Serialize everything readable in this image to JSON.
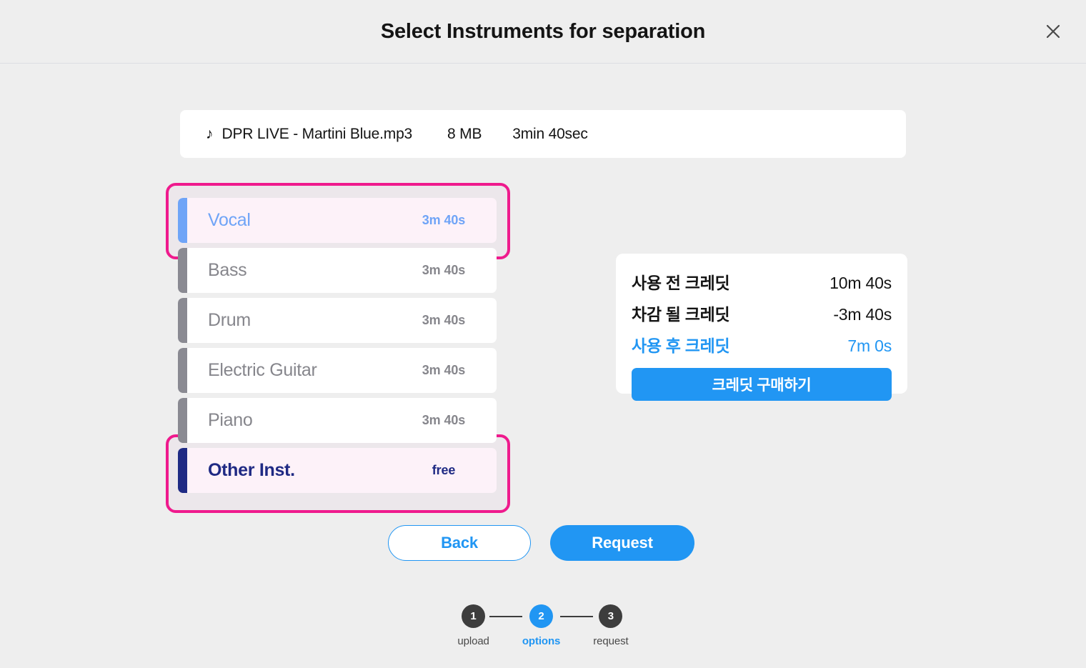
{
  "header": {
    "title": "Select Instruments for separation",
    "close_icon": "close-icon"
  },
  "file": {
    "icon": "music-note-icon",
    "name": "DPR LIVE - Martini Blue.mp3",
    "size": "8 MB",
    "duration": "3min 40sec"
  },
  "instruments": [
    {
      "label": "Vocal",
      "meta": "3m 40s",
      "state": "selected-vocal"
    },
    {
      "label": "Bass",
      "meta": "3m 40s",
      "state": ""
    },
    {
      "label": "Drum",
      "meta": "3m 40s",
      "state": ""
    },
    {
      "label": "Electric Guitar",
      "meta": "3m 40s",
      "state": ""
    },
    {
      "label": "Piano",
      "meta": "3m 40s",
      "state": ""
    },
    {
      "label": "Other Inst.",
      "meta": "free",
      "state": "selected-other"
    }
  ],
  "credits": {
    "before_label": "사용 전 크레딧",
    "before_value": "10m 40s",
    "deduct_label": "차감 될 크레딧",
    "deduct_value": "-3m 40s",
    "after_label": "사용 후 크레딧",
    "after_value": "7m 0s",
    "buy_button": "크레딧 구매하기"
  },
  "actions": {
    "back": "Back",
    "request": "Request"
  },
  "stepper": {
    "steps": [
      {
        "number": "1",
        "label": "upload",
        "active": false
      },
      {
        "number": "2",
        "label": "options",
        "active": true
      },
      {
        "number": "3",
        "label": "request",
        "active": false
      }
    ]
  },
  "colors": {
    "accent_blue": "#2196f3",
    "vocal_blue": "#6fa4f7",
    "other_navy": "#1f2a84",
    "selection_pink": "#ef1a8d",
    "page_bg": "#eeeeee",
    "row_selected_bg": "#fdf2f9",
    "inactive_gray": "#8a8a92"
  }
}
